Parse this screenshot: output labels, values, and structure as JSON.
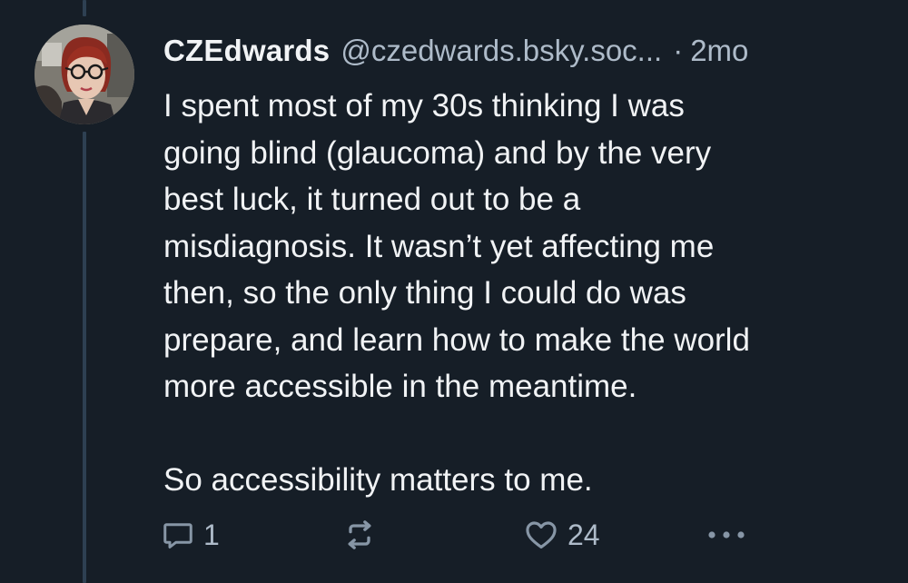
{
  "post": {
    "author": {
      "display_name": "CZEdwards",
      "handle": "@czedwards.bsky.soc...",
      "avatar": "profile-photo"
    },
    "separator": "·",
    "timestamp": "2mo",
    "text_lines_p1": [
      "I spent most of my 30s thinking I was",
      "going blind (glaucoma) and by the very",
      "best luck, it turned out to be a",
      "misdiagnosis. It wasn’t yet affecting me",
      "then, so the only thing I could do was",
      "prepare, and learn how to make the world",
      "more accessible in the meantime."
    ],
    "text_lines_p2": [
      "So accessibility matters to me."
    ],
    "actions": {
      "reply": {
        "icon": "reply-bubble-icon",
        "count": "1"
      },
      "repost": {
        "icon": "repost-icon",
        "count": ""
      },
      "like": {
        "icon": "heart-icon",
        "count": "24"
      },
      "more": {
        "icon": "more-dots-icon"
      }
    }
  },
  "colors": {
    "background": "#161e27",
    "thread_line": "#2e4052",
    "primary_text": "#f1f3f5",
    "secondary_text": "#aebbc9",
    "icon": "#8796a6"
  }
}
